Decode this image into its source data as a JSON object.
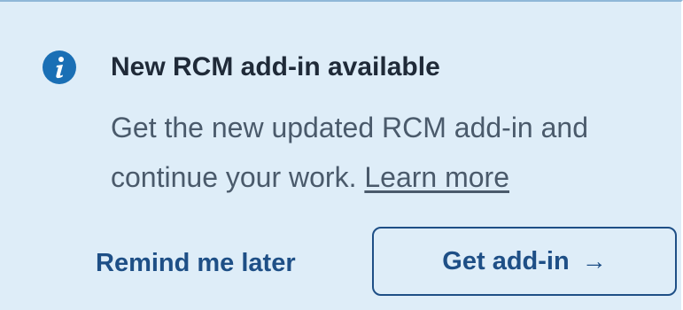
{
  "notification": {
    "icon": "info-icon",
    "title": "New RCM add-in available",
    "message": "Get the new updated RCM add-in and continue your work.",
    "link_label": "Learn more"
  },
  "actions": {
    "remind_label": "Remind me later",
    "get_addin_label": "Get add-in",
    "get_addin_icon": "arrow-right-icon",
    "arrow_glyph": "→"
  },
  "colors": {
    "background": "#deedf8",
    "accent": "#1e4f86",
    "icon": "#1a6fb5"
  }
}
